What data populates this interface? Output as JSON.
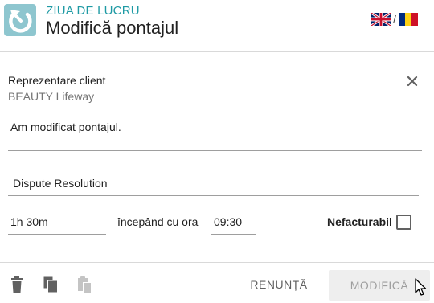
{
  "header": {
    "subtitle": "ZIUA DE LUCRU",
    "title": "Modifică pontajul",
    "language_separator": "/",
    "languages": [
      "English",
      "Română"
    ]
  },
  "client": {
    "label": "Reprezentare client",
    "name": "BEAUTY Lifeway"
  },
  "form": {
    "description": "Am modificat pontajul.",
    "task": "Dispute Resolution",
    "duration": "1h 30m",
    "starting_label": "începând cu ora",
    "start_time": "09:30",
    "non_billable_label": "Nefacturabil",
    "non_billable_checked": false
  },
  "footer": {
    "cancel_label": "RENUNȚĂ",
    "submit_label": "MODIFICĂ",
    "icons": [
      "delete-icon",
      "copy-icon",
      "paste-icon"
    ]
  },
  "colors": {
    "accent": "#1e9aa4",
    "app_icon_bg": "#8ec6cf",
    "disabled_button_bg": "#eeeeee"
  }
}
